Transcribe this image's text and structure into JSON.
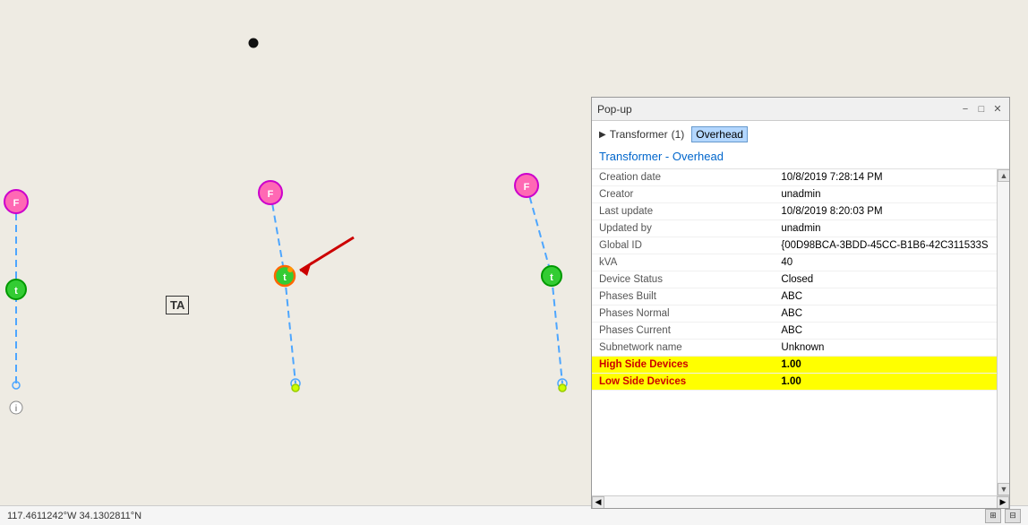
{
  "popup": {
    "title": "Pop-up",
    "controls": {
      "minimize": "−",
      "restore": "□",
      "close": "✕"
    },
    "layer": {
      "name": "Transformer",
      "count": "(1)",
      "selected_item": "Overhead"
    },
    "feature_title": "Transformer - Overhead",
    "attributes": [
      {
        "label": "Creation date",
        "value": "10/8/2019 7:28:14 PM",
        "highlight": false
      },
      {
        "label": "Creator",
        "value": "unadmin",
        "highlight": false
      },
      {
        "label": "Last update",
        "value": "10/8/2019 8:20:03 PM",
        "highlight": false
      },
      {
        "label": "Updated by",
        "value": "unadmin",
        "highlight": false
      },
      {
        "label": "Global ID",
        "value": "{00D98BCA-3BDD-45CC-B1B6-42C311533S",
        "highlight": false
      },
      {
        "label": "kVA",
        "value": "40",
        "highlight": false
      },
      {
        "label": "Device Status",
        "value": "Closed",
        "highlight": false
      },
      {
        "label": "Phases Built",
        "value": "ABC",
        "highlight": false
      },
      {
        "label": "Phases Normal",
        "value": "ABC",
        "highlight": false
      },
      {
        "label": "Phases Current",
        "value": "ABC",
        "highlight": false
      },
      {
        "label": "Subnetwork name",
        "value": "Unknown",
        "highlight": false
      },
      {
        "label": "High Side Devices",
        "value": "1.00",
        "highlight": true
      },
      {
        "label": "Low Side Devices",
        "value": "1.00",
        "highlight": true
      }
    ]
  },
  "statusbar": {
    "coordinates": "117.4611242°W 34.1302811°N"
  },
  "map": {
    "ta_label": "TA"
  }
}
